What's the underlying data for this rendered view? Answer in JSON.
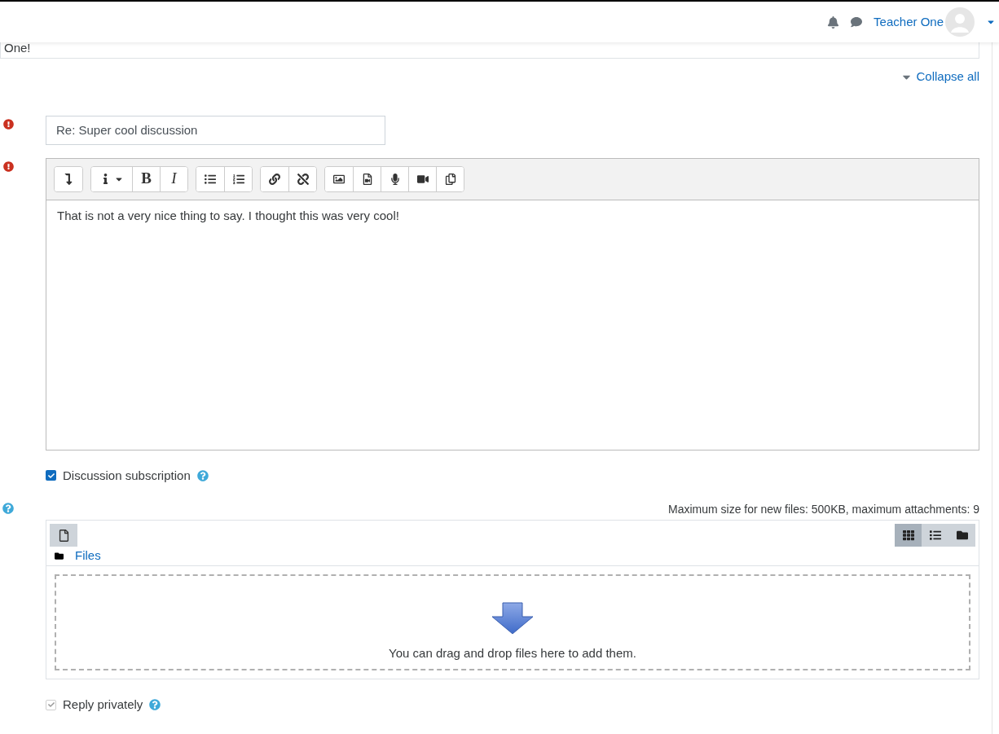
{
  "navbar": {
    "user_name": "Teacher One"
  },
  "previous_post": {
    "text": "One!"
  },
  "collapse_link": "Collapse all",
  "subject": {
    "value": "Re: Super cool discussion",
    "required": true
  },
  "message": {
    "required": true,
    "toolbar": [
      {
        "buttons": [
          {
            "kind": "icon"
          }
        ]
      },
      {
        "buttons": [
          {
            "kind": "dropdown"
          },
          {
            "kind": "text",
            "label": "B"
          },
          {
            "kind": "text",
            "label": "I"
          }
        ]
      },
      {
        "buttons": [
          {
            "kind": "icon"
          },
          {
            "kind": "icon"
          }
        ]
      },
      {
        "buttons": [
          {
            "kind": "icon"
          },
          {
            "kind": "icon"
          }
        ]
      },
      {
        "buttons": [
          {
            "kind": "icon"
          },
          {
            "kind": "icon"
          },
          {
            "kind": "icon"
          },
          {
            "kind": "icon"
          },
          {
            "kind": "icon"
          }
        ]
      }
    ],
    "text": "That is not a very nice thing to say. I thought this was very cool!"
  },
  "discussion_subscription": {
    "label": "Discussion subscription",
    "checked": true,
    "disabled": false
  },
  "attachments": {
    "limits": "Maximum size for new files: 500KB, maximum attachments: 9",
    "views": [
      {
        "selected": true
      },
      {
        "selected": false
      },
      {
        "selected": false
      }
    ],
    "path": "Files",
    "drop_hint": "You can drag and drop files here to add them."
  },
  "reply_privately": {
    "label": "Reply privately",
    "checked": true,
    "disabled": true
  }
}
